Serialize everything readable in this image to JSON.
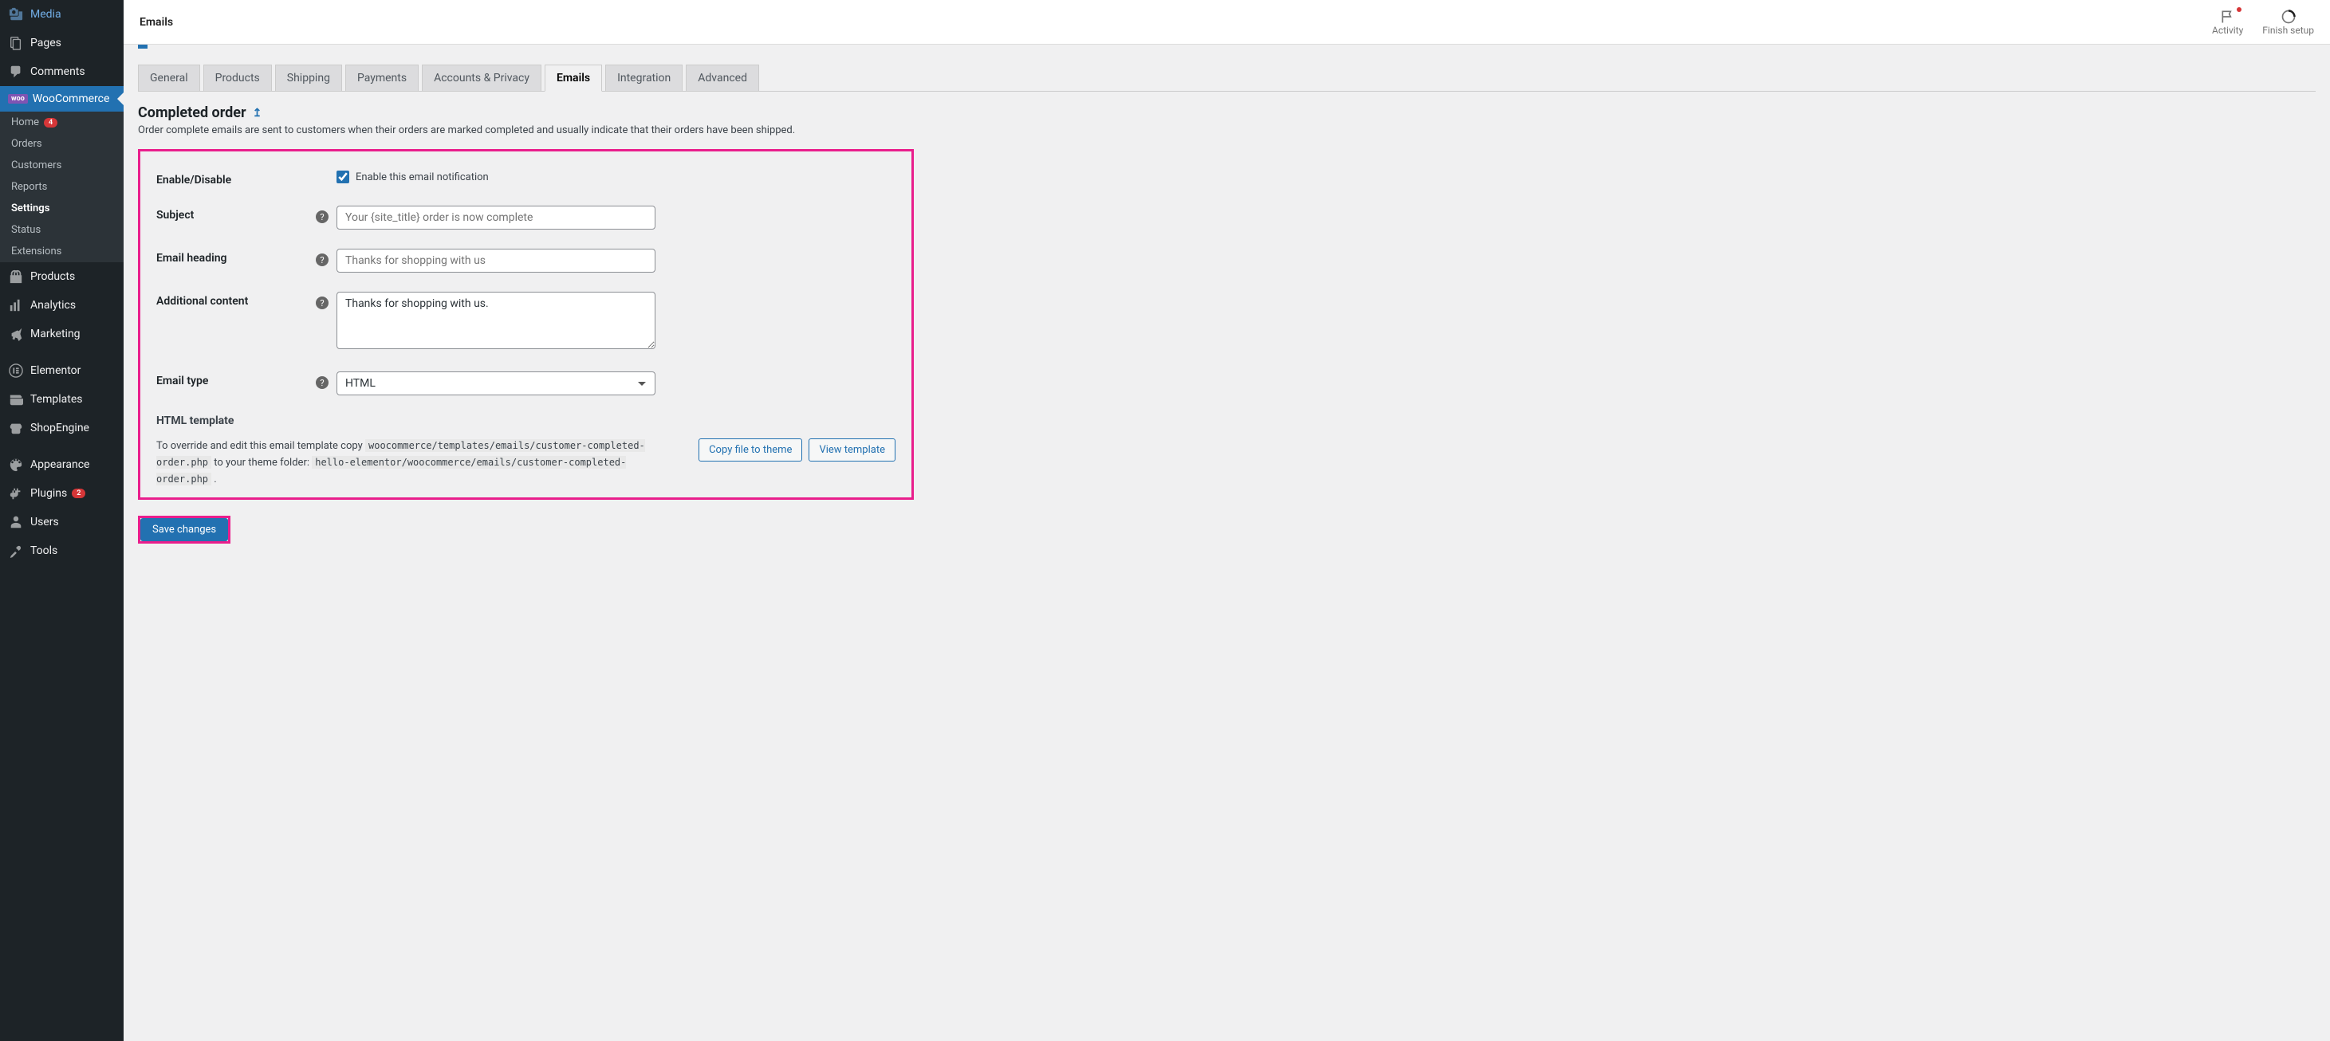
{
  "sidebar": {
    "items": [
      {
        "label": "Media",
        "icon": "media"
      },
      {
        "label": "Pages",
        "icon": "pages"
      },
      {
        "label": "Comments",
        "icon": "comments"
      },
      {
        "label": "WooCommerce",
        "icon": "woocommerce",
        "active": true
      },
      {
        "label": "Products",
        "icon": "products"
      },
      {
        "label": "Analytics",
        "icon": "analytics"
      },
      {
        "label": "Marketing",
        "icon": "marketing"
      },
      {
        "label": "Elementor",
        "icon": "elementor"
      },
      {
        "label": "Templates",
        "icon": "templates"
      },
      {
        "label": "ShopEngine",
        "icon": "shopengine"
      },
      {
        "label": "Appearance",
        "icon": "appearance"
      },
      {
        "label": "Plugins",
        "icon": "plugins",
        "badge": "2"
      },
      {
        "label": "Users",
        "icon": "users"
      },
      {
        "label": "Tools",
        "icon": "tools"
      }
    ],
    "submenu": [
      {
        "label": "Home",
        "badge": "4"
      },
      {
        "label": "Orders"
      },
      {
        "label": "Customers"
      },
      {
        "label": "Reports"
      },
      {
        "label": "Settings",
        "active": true
      },
      {
        "label": "Status"
      },
      {
        "label": "Extensions"
      }
    ]
  },
  "topbar": {
    "title": "Emails",
    "actions": {
      "activity": "Activity",
      "finish_setup": "Finish setup"
    }
  },
  "tabs": [
    "General",
    "Products",
    "Shipping",
    "Payments",
    "Accounts & Privacy",
    "Emails",
    "Integration",
    "Advanced"
  ],
  "active_tab": "Emails",
  "page": {
    "heading": "Completed order",
    "back_icon": "↥",
    "description": "Order complete emails are sent to customers when their orders are marked completed and usually indicate that their orders have been shipped."
  },
  "form": {
    "enable_disable": {
      "label": "Enable/Disable",
      "checkbox_label": "Enable this email notification",
      "checked": true
    },
    "subject": {
      "label": "Subject",
      "placeholder": "Your {site_title} order is now complete",
      "value": ""
    },
    "email_heading": {
      "label": "Email heading",
      "placeholder": "Thanks for shopping with us",
      "value": ""
    },
    "additional_content": {
      "label": "Additional content",
      "value": "Thanks for shopping with us."
    },
    "email_type": {
      "label": "Email type",
      "value": "HTML"
    },
    "html_template": {
      "heading": "HTML template",
      "prefix": "To override and edit this email template copy",
      "code1": "woocommerce/templates/emails/customer-completed-order.php",
      "mid": "to your theme folder:",
      "code2": "hello-elementor/woocommerce/emails/customer-completed-order.php",
      "suffix": ".",
      "copy_btn": "Copy file to theme",
      "view_btn": "View template"
    },
    "save": "Save changes"
  }
}
